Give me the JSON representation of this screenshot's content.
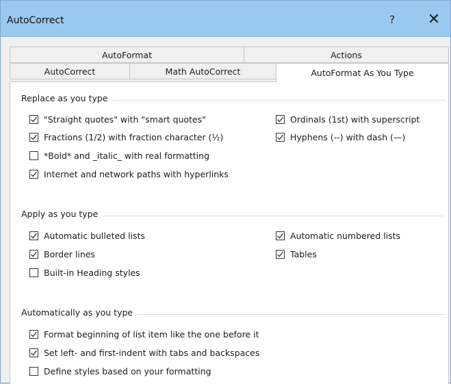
{
  "dialog": {
    "title": "AutoCorrect",
    "help_label": "?",
    "close_label": "✕"
  },
  "tabs": {
    "row1": [
      {
        "label": "AutoFormat"
      },
      {
        "label": "Actions"
      }
    ],
    "row2": [
      {
        "label": "AutoCorrect"
      },
      {
        "label": "Math AutoCorrect"
      },
      {
        "label": "AutoFormat As You Type",
        "active": true
      }
    ]
  },
  "sections": {
    "replace": {
      "title": "Replace as you type",
      "options": [
        {
          "label": "\"Straight quotes\" with \"smart quotes\"",
          "checked": true
        },
        {
          "label": "Ordinals (1st) with superscript",
          "checked": true
        },
        {
          "label": "Fractions (1/2) with fraction character (½)",
          "checked": true
        },
        {
          "label": "Hyphens (--) with dash (—)",
          "checked": true
        },
        {
          "label": "*Bold* and _italic_ with real formatting",
          "checked": false
        },
        {
          "label": "Internet and network paths with hyperlinks",
          "checked": true
        }
      ]
    },
    "apply": {
      "title": "Apply as you type",
      "options": [
        {
          "label": "Automatic bulleted lists",
          "checked": true
        },
        {
          "label": "Automatic numbered lists",
          "checked": true
        },
        {
          "label": "Border lines",
          "checked": true
        },
        {
          "label": "Tables",
          "checked": true
        },
        {
          "label": "Built-in Heading styles",
          "checked": false
        }
      ]
    },
    "automatic": {
      "title": "Automatically as you type",
      "options": [
        {
          "label": "Format beginning of list item like the one before it",
          "checked": true
        },
        {
          "label": "Set left- and first-indent with tabs and backspaces",
          "checked": true
        },
        {
          "label": "Define styles based on your formatting",
          "checked": false
        }
      ]
    }
  }
}
